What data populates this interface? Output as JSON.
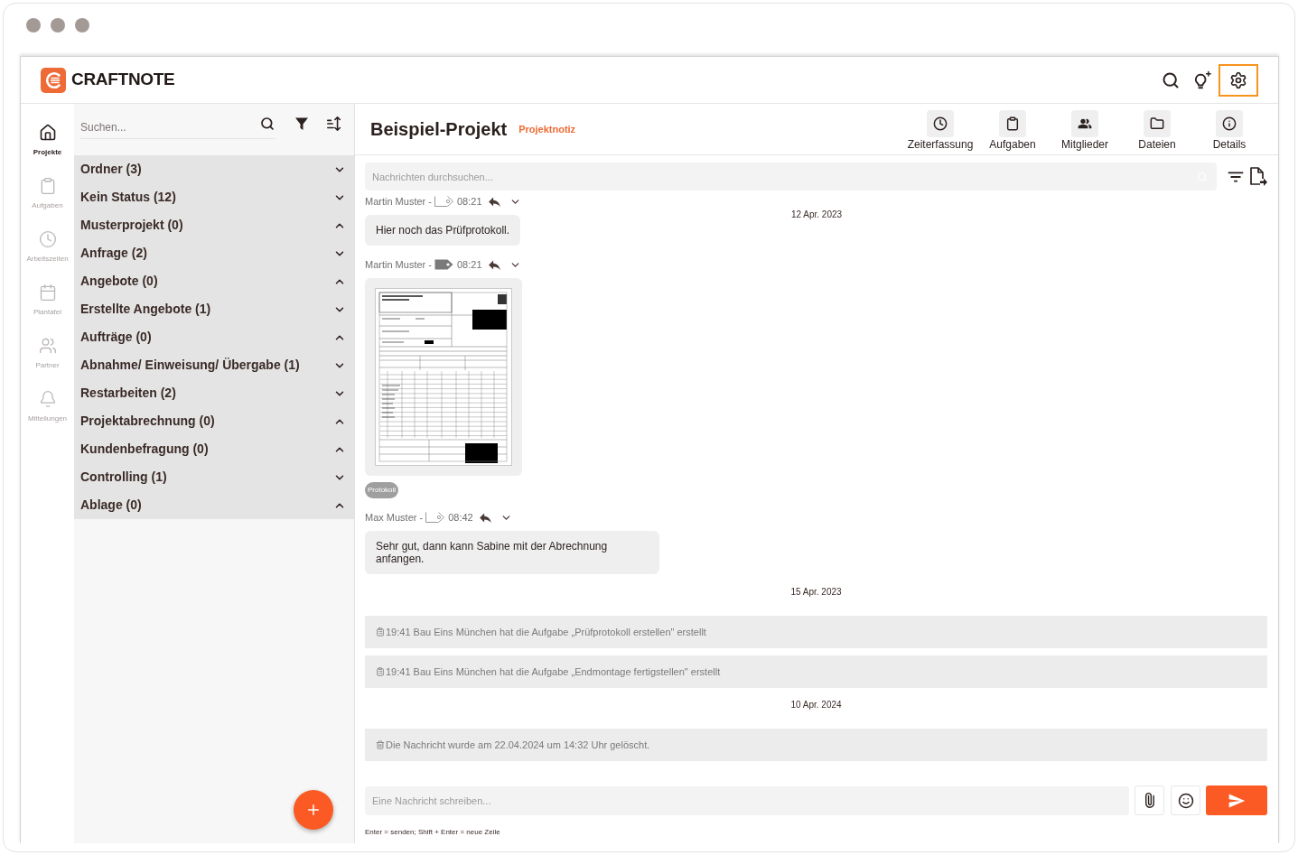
{
  "header": {
    "logo_text": "CRAFTNOTE",
    "actions": [
      {
        "highlighted": false
      },
      {
        "highlighted": false
      },
      {
        "highlighted": true
      }
    ]
  },
  "nav": [
    {
      "label": "Projekte",
      "selected": true
    },
    {
      "label": "Aufgaben",
      "selected": false
    },
    {
      "label": "Arbeitszeiten",
      "selected": false
    },
    {
      "label": "Plantafel",
      "selected": false
    },
    {
      "label": "Partner",
      "selected": false
    },
    {
      "label": "Mitteilungen",
      "selected": false
    }
  ],
  "folder_panel": {
    "search": {
      "placeholder": "Suchen..."
    },
    "folders": [
      {
        "label": "Ordner (3)",
        "expanded": false
      },
      {
        "label": "Kein Status (12)",
        "expanded": false
      },
      {
        "label": "Musterprojekt (0)",
        "expanded": true
      },
      {
        "label": "Anfrage (2)",
        "expanded": false
      },
      {
        "label": "Angebote (0)",
        "expanded": true
      },
      {
        "label": "Erstellte Angebote (1)",
        "expanded": false
      },
      {
        "label": "Aufträge (0)",
        "expanded": true
      },
      {
        "label": "Abnahme/ Einweisung/ Übergabe (1)",
        "expanded": false
      },
      {
        "label": "Restarbeiten (2)",
        "expanded": false
      },
      {
        "label": "Projektabrechnung (0)",
        "expanded": true
      },
      {
        "label": "Kundenbefragung (0)",
        "expanded": true
      },
      {
        "label": "Controlling (1)",
        "expanded": false
      },
      {
        "label": "Ablage (0)",
        "expanded": true
      }
    ]
  },
  "project": {
    "title": "Beispiel-Projekt",
    "note_label": "Projektnotiz",
    "tabs": [
      "Zeiterfassung",
      "Aufgaben",
      "Mitglieder",
      "Dateien",
      "Details"
    ]
  },
  "chat": {
    "search": {
      "placeholder": "Nachrichten durchsuchen..."
    },
    "timeline": [
      {
        "kind": "date",
        "text": "12 Apr. 2023",
        "sticky": true
      },
      {
        "kind": "message",
        "sender": "Martin Muster -",
        "time": "08:21",
        "tagged": false,
        "text": "Hier noch das Prüfprotokoll."
      },
      {
        "kind": "attachment",
        "sender": "Martin Muster -",
        "time": "08:21",
        "tagged": true,
        "tags": [
          "Protokoll"
        ]
      },
      {
        "kind": "message",
        "sender": "Max Muster -",
        "time": "08:42",
        "tagged": false,
        "text": "Sehr gut, dann kann Sabine mit der Abrechnung anfangen."
      },
      {
        "kind": "date",
        "text": "15 Apr. 2023",
        "sticky": false
      },
      {
        "kind": "event",
        "text": "19:41 Bau Eins München hat die Aufgabe „Prüfprotokoll erstellen\" erstellt"
      },
      {
        "kind": "event",
        "text": "19:41 Bau Eins München hat die Aufgabe „Endmontage fertigstellen\" erstellt"
      },
      {
        "kind": "date",
        "text": "10 Apr. 2024",
        "sticky": false
      },
      {
        "kind": "deleted",
        "text": "Die Nachricht wurde am 22.04.2024 um 14:32 Uhr gelöscht."
      }
    ],
    "composer": {
      "placeholder": "Eine Nachricht schreiben..."
    },
    "hint": "Enter = senden; Shift + Enter = neue Zeile"
  }
}
